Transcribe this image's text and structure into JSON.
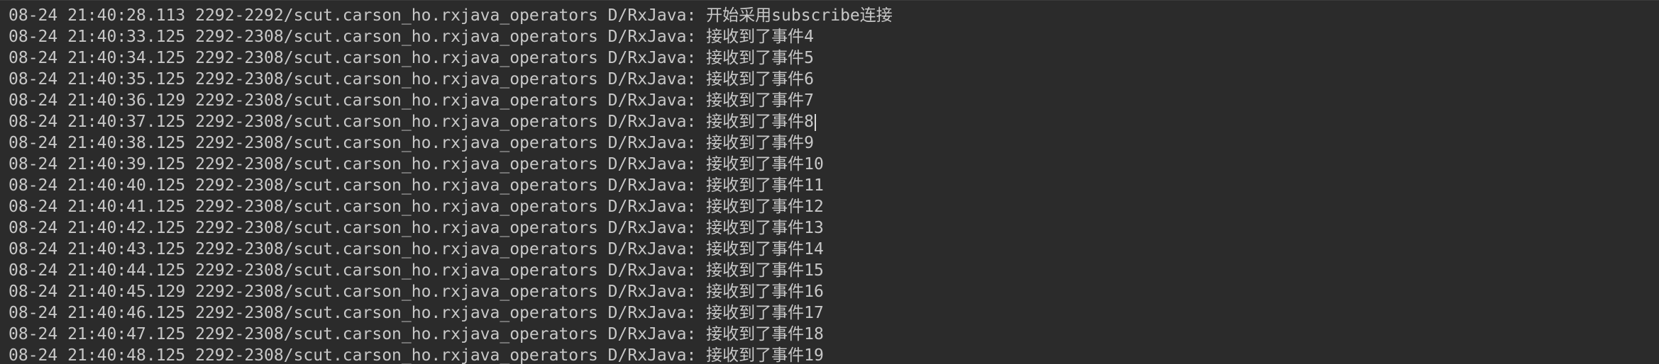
{
  "log": {
    "lines": [
      "08-24 21:40:28.113 2292-2292/scut.carson_ho.rxjava_operators D/RxJava: 开始采用subscribe连接",
      "08-24 21:40:33.125 2292-2308/scut.carson_ho.rxjava_operators D/RxJava: 接收到了事件4",
      "08-24 21:40:34.125 2292-2308/scut.carson_ho.rxjava_operators D/RxJava: 接收到了事件5",
      "08-24 21:40:35.125 2292-2308/scut.carson_ho.rxjava_operators D/RxJava: 接收到了事件6",
      "08-24 21:40:36.129 2292-2308/scut.carson_ho.rxjava_operators D/RxJava: 接收到了事件7",
      "08-24 21:40:37.125 2292-2308/scut.carson_ho.rxjava_operators D/RxJava: 接收到了事件8",
      "08-24 21:40:38.125 2292-2308/scut.carson_ho.rxjava_operators D/RxJava: 接收到了事件9",
      "08-24 21:40:39.125 2292-2308/scut.carson_ho.rxjava_operators D/RxJava: 接收到了事件10",
      "08-24 21:40:40.125 2292-2308/scut.carson_ho.rxjava_operators D/RxJava: 接收到了事件11",
      "08-24 21:40:41.125 2292-2308/scut.carson_ho.rxjava_operators D/RxJava: 接收到了事件12",
      "08-24 21:40:42.125 2292-2308/scut.carson_ho.rxjava_operators D/RxJava: 接收到了事件13",
      "08-24 21:40:43.125 2292-2308/scut.carson_ho.rxjava_operators D/RxJava: 接收到了事件14",
      "08-24 21:40:44.125 2292-2308/scut.carson_ho.rxjava_operators D/RxJava: 接收到了事件15",
      "08-24 21:40:45.129 2292-2308/scut.carson_ho.rxjava_operators D/RxJava: 接收到了事件16",
      "08-24 21:40:46.125 2292-2308/scut.carson_ho.rxjava_operators D/RxJava: 接收到了事件17",
      "08-24 21:40:47.125 2292-2308/scut.carson_ho.rxjava_operators D/RxJava: 接收到了事件18",
      "08-24 21:40:48.125 2292-2308/scut.carson_ho.rxjava_operators D/RxJava: 接收到了事件19"
    ],
    "caret_line": 5
  }
}
